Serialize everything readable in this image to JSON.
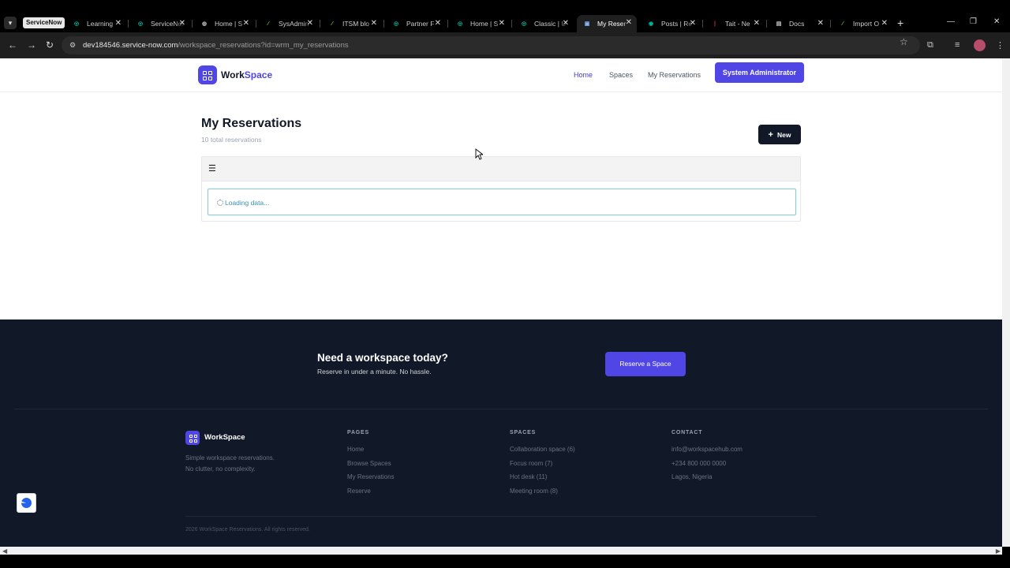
{
  "browser": {
    "tab_group": "ServiceNow",
    "tabs": [
      {
        "title": "Learning",
        "favicon": "servicenow-icon",
        "color": "#00c2a8",
        "active": false
      },
      {
        "title": "ServiceNow",
        "favicon": "servicenow-icon",
        "color": "#00c2a8",
        "active": false
      },
      {
        "title": "Home | S",
        "favicon": "globe-icon",
        "color": "#bbbbbb",
        "active": false
      },
      {
        "title": "SysAdmin",
        "favicon": "leaf-icon",
        "color": "#7bd135",
        "active": false
      },
      {
        "title": "ITSM blo",
        "favicon": "leaf-icon",
        "color": "#7bd135",
        "active": false
      },
      {
        "title": "Partner F",
        "favicon": "servicenow-icon",
        "color": "#00c2a8",
        "active": false
      },
      {
        "title": "Home | S",
        "favicon": "servicenow-icon",
        "color": "#00c2a8",
        "active": false
      },
      {
        "title": "Classic | U",
        "favicon": "servicenow-icon",
        "color": "#00c2a8",
        "active": false
      },
      {
        "title": "My Reser",
        "favicon": "workspace-icon",
        "color": "#8ab4f8",
        "active": true
      },
      {
        "title": "Posts | Re",
        "favicon": "reddit-icon",
        "color": "#00c2a8",
        "active": false
      },
      {
        "title": "Tait - Ne",
        "favicon": "tait-icon",
        "color": "#e0245e",
        "active": false
      },
      {
        "title": "Docs",
        "favicon": "doc-icon",
        "color": "#cccccc",
        "active": false
      },
      {
        "title": "Import O",
        "favicon": "leaf-icon",
        "color": "#7bd135",
        "active": false
      }
    ],
    "url_host": "dev184546.service-now.com",
    "url_path": "/workspace_reservations?id=wrm_my_reservations"
  },
  "header": {
    "brand_a": "Work",
    "brand_b": "Space",
    "nav": [
      "Home",
      "Spaces",
      "My Reservations"
    ],
    "user_button": "System Administrator"
  },
  "main": {
    "title": "My Reservations",
    "subtitle": "10 total reservations",
    "new_button": "New",
    "loading": "Loading data..."
  },
  "cta": {
    "title": "Need a workspace today?",
    "subtitle": "Reserve in under a minute. No hassle.",
    "button": "Reserve a Space"
  },
  "footer": {
    "brand": "WorkSpace",
    "tagline_1": "Simple workspace reservations.",
    "tagline_2": "No clutter, no complexity.",
    "pages": {
      "heading": "PAGES",
      "items": [
        "Home",
        "Browse Spaces",
        "My Reservations",
        "Reserve"
      ]
    },
    "spaces": {
      "heading": "SPACES",
      "items": [
        "Collaboration space (6)",
        "Focus room (7)",
        "Hot desk (11)",
        "Meeting room (8)"
      ]
    },
    "contact": {
      "heading": "CONTACT",
      "items": [
        "info@workspacehub.com",
        "+234 800 000 0000",
        "Lagos, Nigeria"
      ]
    },
    "copyright": "2026 WorkSpace Reservations. All rights reserved."
  },
  "colors": {
    "accent": "#4f46e5",
    "dark": "#111827"
  }
}
